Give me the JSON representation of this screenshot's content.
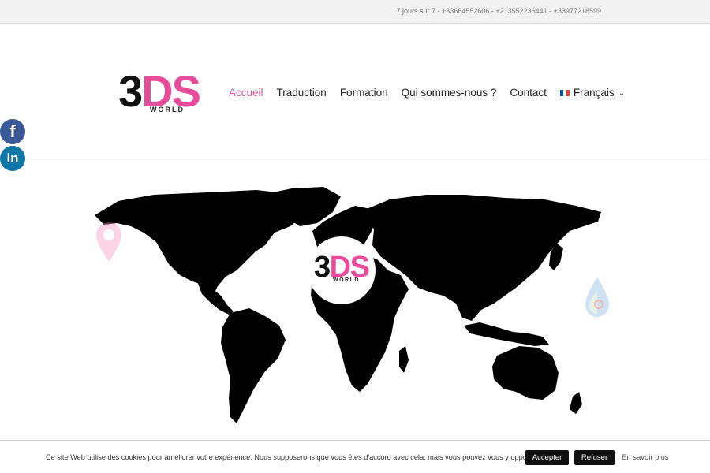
{
  "topbar": {
    "phones": "7 jours sur 7 - +33664552606 - +213552236441 - +33977218599"
  },
  "logo": {
    "num_dark": "3",
    "num_pink": "DS",
    "sub": "WORLD"
  },
  "nav": {
    "items": [
      "Accueil",
      "Traduction",
      "Formation",
      "Qui sommes-nous ?",
      "Contact"
    ],
    "language": "Français"
  },
  "social": {
    "facebook": "f",
    "linkedin": "in"
  },
  "cookie": {
    "message": "Ce site Web utilise des cookies pour améliorer votre expérience. Nous supposerons que vous êtes d'accord avec cela, mais vous pouvez vous y opposez.",
    "accept": "Accepter",
    "refuse": "Refuser",
    "more": "En savoir plus"
  },
  "colors": {
    "accent": "#e84c9b",
    "facebook": "#3b5998",
    "linkedin": "#0e76a8"
  },
  "icons": [
    "facebook-icon",
    "linkedin-icon",
    "france-flag-icon",
    "chevron-down-icon",
    "map-pin-icon",
    "algeria-flag-drop-icon",
    "world-map"
  ]
}
